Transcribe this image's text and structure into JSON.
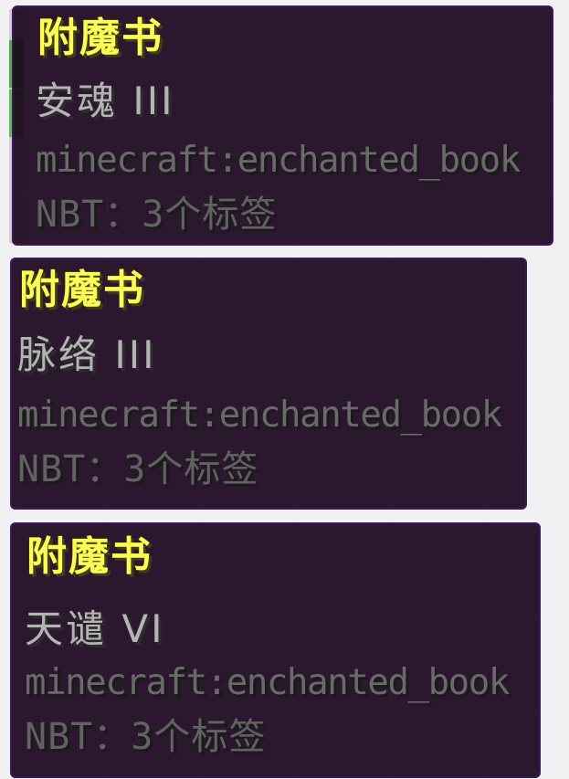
{
  "tooltips": [
    {
      "title": "附魔书",
      "enchantment": "安魂 III",
      "item_id": "minecraft:enchanted_book",
      "nbt": "NBT：3个标签"
    },
    {
      "title": "附魔书",
      "enchantment": "脉络 III",
      "item_id": "minecraft:enchanted_book",
      "nbt": "NBT：3个标签"
    },
    {
      "title": "附魔书",
      "enchantment": "天谴 VI",
      "item_id": "minecraft:enchanted_book",
      "nbt": "NBT：3个标签"
    }
  ],
  "colors": {
    "title": "#fcfc54",
    "enchantment": "#b4b4b4",
    "detail": "#6a6a6a",
    "tooltip_background": "#1c081e",
    "tooltip_border": "#501482"
  }
}
